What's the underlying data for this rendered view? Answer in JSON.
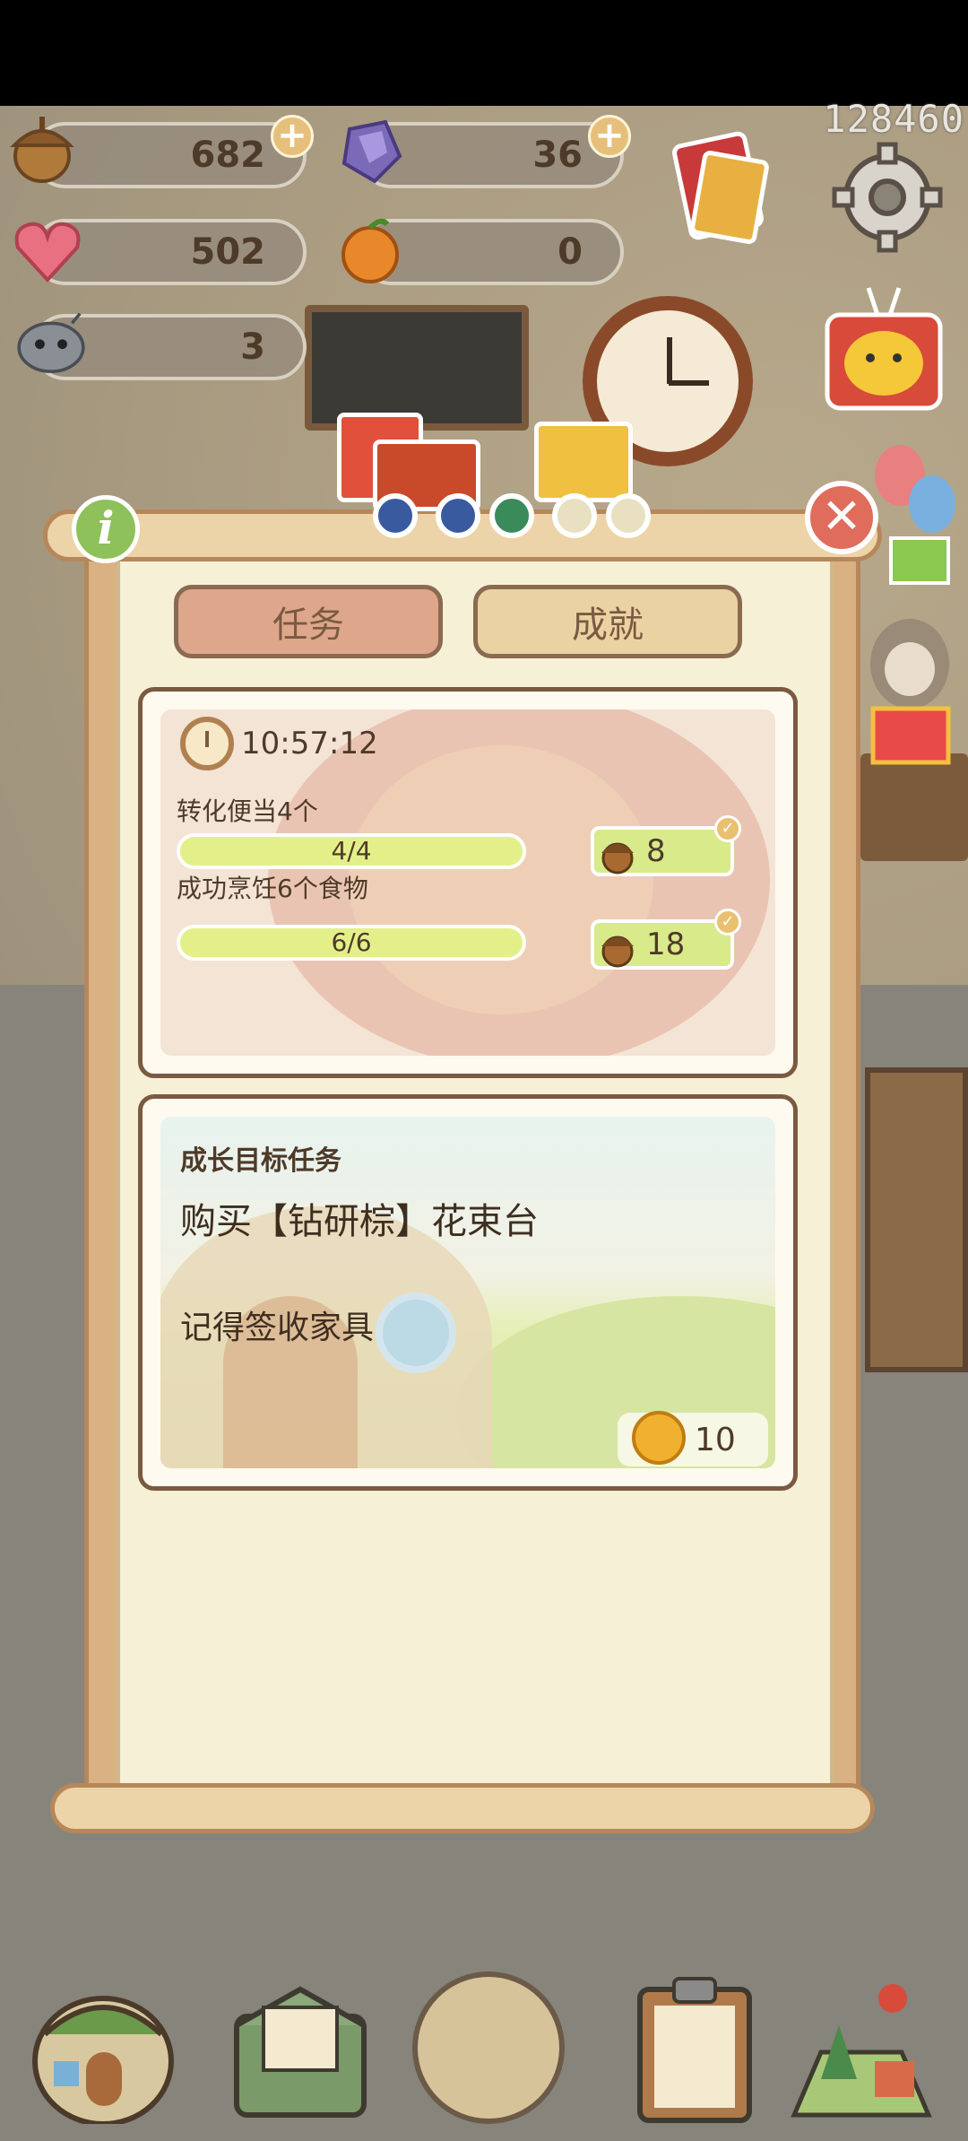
{
  "hud": {
    "acorn_count": "682",
    "gem_count": "36",
    "heart_count": "502",
    "orange_count": "0",
    "robot_count": "3",
    "score": "128460"
  },
  "tabs": [
    {
      "label": "任务",
      "active": true
    },
    {
      "label": "成就",
      "active": false
    }
  ],
  "daily_card": {
    "timer": "10:57:12",
    "tasks": [
      {
        "label": "转化便当4个",
        "progress_text": "4/4",
        "progress": 1.0,
        "reward": "8",
        "completed": true
      },
      {
        "label": "成功烹饪6个食物",
        "progress_text": "6/6",
        "progress": 1.0,
        "reward": "18",
        "completed": true
      }
    ]
  },
  "growth_card": {
    "title": "成长目标任务",
    "task": "购买【钻研棕】花束台",
    "hint": "记得签收家具",
    "reward": "10"
  },
  "icons": {
    "acorn": "acorn-icon",
    "gem": "gem-icon",
    "heart": "heart-icon",
    "orange": "orange-icon",
    "robot": "robot-icon",
    "bell": "bell-icon",
    "close": "close-icon",
    "info": "info-icon",
    "settings": "gear-icon"
  },
  "colors": {
    "active_tab": "#dea68a",
    "inactive_tab": "#ebd2a2",
    "progress_fill": "#e3f08a",
    "close": "#e06c5c",
    "info": "#8ec15a"
  }
}
